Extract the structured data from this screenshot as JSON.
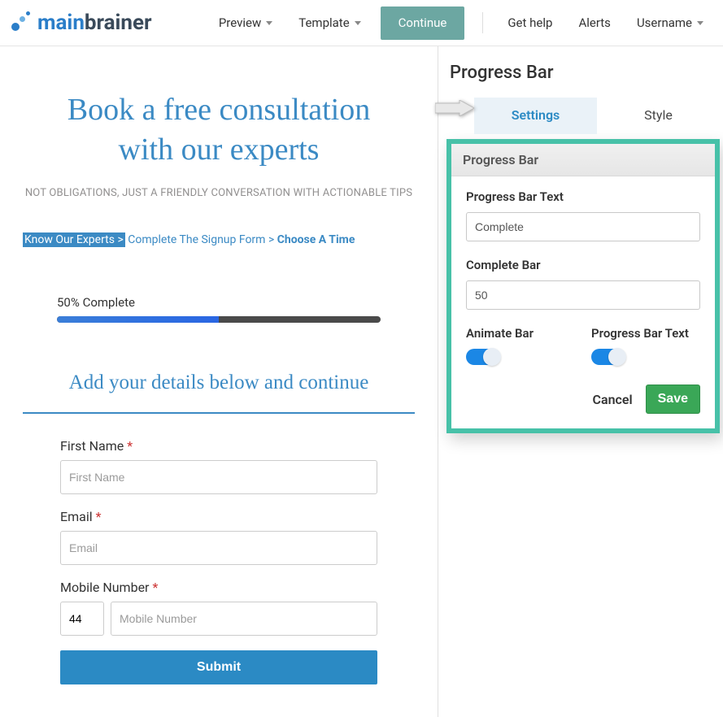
{
  "header": {
    "logo_part1": "main",
    "logo_part2": "brainer",
    "nav": {
      "preview": "Preview",
      "template": "Template",
      "continue": "Continue",
      "get_help": "Get help",
      "alerts": "Alerts",
      "username": "Username"
    }
  },
  "left": {
    "hero_line1": "Book a free consultation",
    "hero_line2": "with our experts",
    "hero_sub": "NOT OBLIGATIONS, JUST A FRIENDLY CONVERSATION WITH ACTIONABLE TIPS",
    "breadcrumb": {
      "step1": "Know Our Experts >",
      "step2": "Complete The Signup Form",
      "sep": " > ",
      "step3": "Choose A Time"
    },
    "progress": {
      "label": "50% Complete",
      "percent": 50
    },
    "section_title": "Add your details below and continue",
    "form": {
      "first_name_label": "First Name",
      "first_name_placeholder": "First Name",
      "email_label": "Email",
      "email_placeholder": "Email",
      "mobile_label": "Mobile Number",
      "cc_value": "44",
      "mobile_placeholder": "Mobile Number",
      "submit": "Submit"
    }
  },
  "right": {
    "heading": "Progress Bar",
    "tabs": {
      "settings": "Settings",
      "style": "Style"
    },
    "panel": {
      "title": "Progress Bar",
      "text_label": "Progress Bar Text",
      "text_value": "Complete",
      "complete_label": "Complete Bar",
      "complete_value": "50",
      "animate_label": "Animate Bar",
      "progress_text_label": "Progress Bar Text",
      "cancel": "Cancel",
      "save": "Save"
    }
  }
}
